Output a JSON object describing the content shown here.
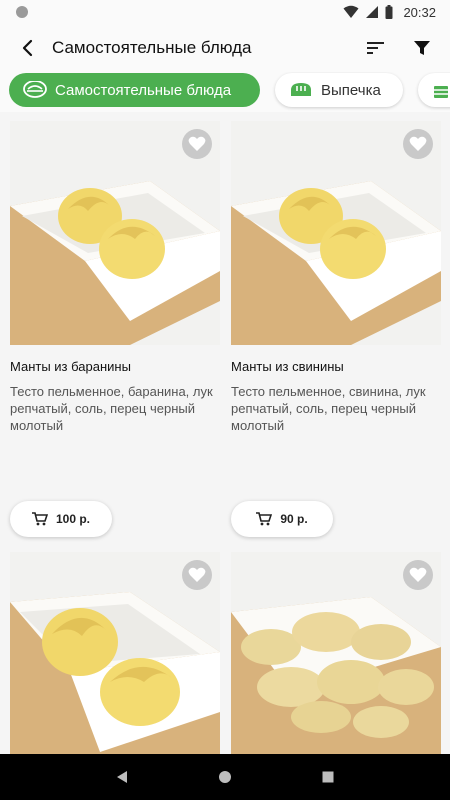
{
  "status": {
    "time": "20:32"
  },
  "appbar": {
    "title": "Самостоятельные блюда",
    "back_icon": "arrow-back-icon",
    "sort_icon": "sort-icon",
    "filter_icon": "filter-icon"
  },
  "chips": [
    {
      "label": "Самостоятельные блюда",
      "active": true,
      "icon": "bowl-icon"
    },
    {
      "label": "Выпечка",
      "active": false,
      "icon": "bread-icon"
    },
    {
      "label": "",
      "active": false,
      "icon": "cake-icon"
    }
  ],
  "products": [
    {
      "title": "Манты из баранины",
      "description": "Тесто пельменное, баранина, лук репчатый, соль, перец черный молотый",
      "price": "100 р."
    },
    {
      "title": "Манты из свинины",
      "description": "Тесто пельменное, свинина, лук репчатый, соль, перец черный молотый",
      "price": "90 р."
    },
    {
      "title": "",
      "description": "",
      "price": ""
    },
    {
      "title": "",
      "description": "",
      "price": ""
    }
  ],
  "colors": {
    "accent": "#4caf50",
    "background": "#f5f5f5",
    "card": "#ffffff",
    "fav_bg": "#c9c9c9"
  }
}
